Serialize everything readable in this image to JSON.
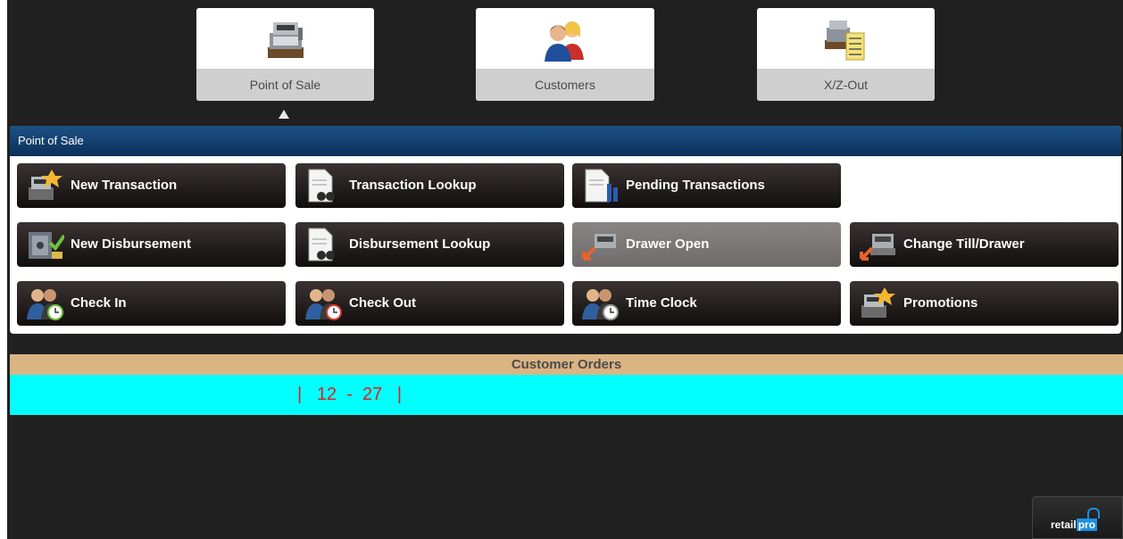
{
  "nav": {
    "tiles": [
      {
        "label": "Point of Sale",
        "icon": "cash-register-icon",
        "active": true
      },
      {
        "label": "Customers",
        "icon": "customers-icon",
        "active": false
      },
      {
        "label": "X/Z-Out",
        "icon": "register-receipt-icon",
        "active": false
      }
    ]
  },
  "pos": {
    "title": "Point of Sale",
    "buttons": [
      {
        "label": "New Transaction",
        "icon": "new-transaction-icon",
        "enabled": true
      },
      {
        "label": "Transaction Lookup",
        "icon": "document-binoculars-icon",
        "enabled": true
      },
      {
        "label": "Pending Transactions",
        "icon": "pending-document-icon",
        "enabled": true
      },
      {
        "label": "New Disbursement",
        "icon": "disbursement-safe-icon",
        "enabled": true
      },
      {
        "label": "Disbursement Lookup",
        "icon": "document-binoculars-icon",
        "enabled": true
      },
      {
        "label": "Drawer Open",
        "icon": "drawer-open-icon",
        "enabled": false
      },
      {
        "label": "Change Till/Drawer",
        "icon": "change-drawer-icon",
        "enabled": true
      },
      {
        "label": "Check In",
        "icon": "check-in-icon",
        "enabled": true
      },
      {
        "label": "Check Out",
        "icon": "check-out-icon",
        "enabled": true
      },
      {
        "label": "Time Clock",
        "icon": "time-clock-icon",
        "enabled": true
      },
      {
        "label": "Promotions",
        "icon": "promotions-icon",
        "enabled": true
      }
    ]
  },
  "orders": {
    "title": "Customer Orders",
    "range_text": "|   12  -  27   |"
  },
  "logo": {
    "retail": "retail",
    "pro": "pro"
  },
  "colors": {
    "panel_header": "#0b2f5a",
    "orders_header": "#dbb484",
    "orders_bar": "#00ffff",
    "range_text": "#e02020"
  }
}
